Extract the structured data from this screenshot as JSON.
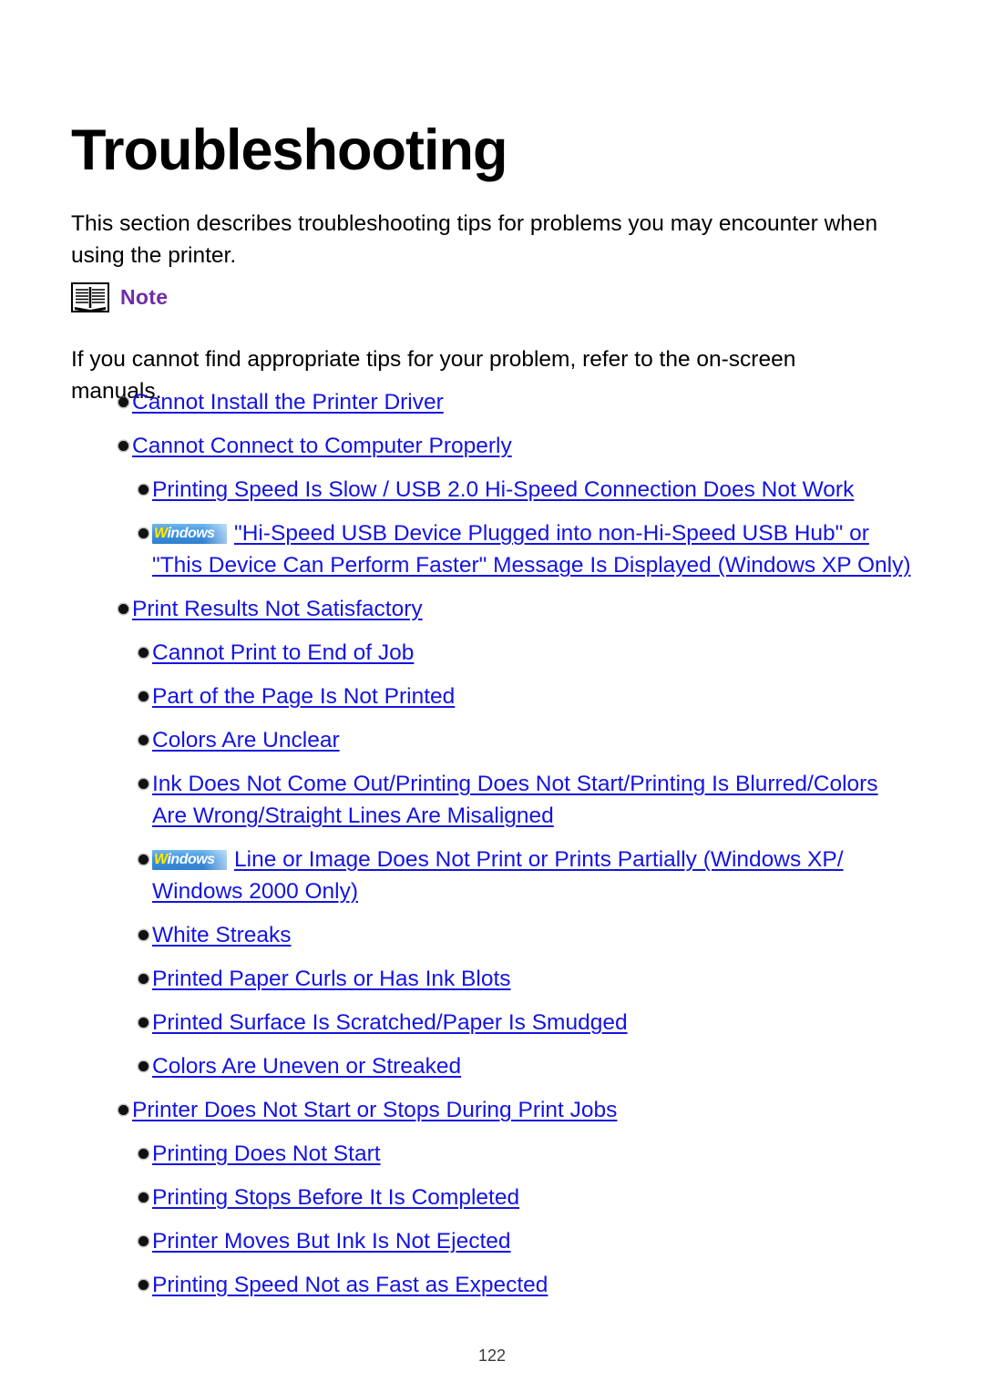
{
  "page": {
    "title": "Troubleshooting",
    "intro": "This section describes troubleshooting tips for problems you may encounter when using the printer.",
    "page_number": "122"
  },
  "note": {
    "icon": "open-book-icon",
    "label": "Note",
    "body": "If you cannot find appropriate tips for your problem, refer to the on-screen manuals."
  },
  "colors": {
    "link": "#1414e0",
    "note_label": "#6f2da8",
    "text": "#000000",
    "badge_bg": "#3f93e0",
    "badge_w": "#ffe800"
  },
  "badge": {
    "name": "windows-badge-icon",
    "w": "W",
    "rest": "indows"
  },
  "links": [
    {
      "level": 1,
      "badge": false,
      "label": "Cannot Install the Printer Driver"
    },
    {
      "level": 1,
      "badge": false,
      "label": "Cannot Connect to Computer Properly"
    },
    {
      "level": 2,
      "badge": false,
      "label": "Printing Speed Is Slow / USB 2.0 Hi-Speed Connection Does Not Work"
    },
    {
      "level": 2,
      "badge": true,
      "label": "\"Hi-Speed USB Device Plugged into non-Hi-Speed USB Hub\" or \"This Device Can Perform Faster\" Message Is Displayed (Windows XP Only)"
    },
    {
      "level": 1,
      "badge": false,
      "label": "Print Results Not Satisfactory"
    },
    {
      "level": 2,
      "badge": false,
      "label": "Cannot Print to End of Job"
    },
    {
      "level": 2,
      "badge": false,
      "label": "Part of the Page Is Not Printed"
    },
    {
      "level": 2,
      "badge": false,
      "label": "Colors Are Unclear"
    },
    {
      "level": 2,
      "badge": false,
      "label": "Ink Does Not Come Out/Printing Does Not Start/Printing Is Blurred/Colors Are Wrong/Straight Lines Are Misaligned"
    },
    {
      "level": 2,
      "badge": true,
      "label": "Line or Image Does Not Print or Prints Partially (Windows XP/ Windows 2000 Only)"
    },
    {
      "level": 2,
      "badge": false,
      "label": "White Streaks"
    },
    {
      "level": 2,
      "badge": false,
      "label": "Printed Paper Curls or Has Ink Blots"
    },
    {
      "level": 2,
      "badge": false,
      "label": "Printed Surface Is Scratched/Paper Is Smudged"
    },
    {
      "level": 2,
      "badge": false,
      "label": "Colors Are Uneven or Streaked"
    },
    {
      "level": 1,
      "badge": false,
      "label": "Printer Does Not Start or Stops During Print Jobs"
    },
    {
      "level": 2,
      "badge": false,
      "label": "Printing Does Not Start"
    },
    {
      "level": 2,
      "badge": false,
      "label": "Printing Stops Before It Is Completed"
    },
    {
      "level": 2,
      "badge": false,
      "label": "Printer Moves But Ink Is Not Ejected"
    },
    {
      "level": 2,
      "badge": false,
      "label": "Printing Speed Not as Fast as Expected"
    }
  ]
}
